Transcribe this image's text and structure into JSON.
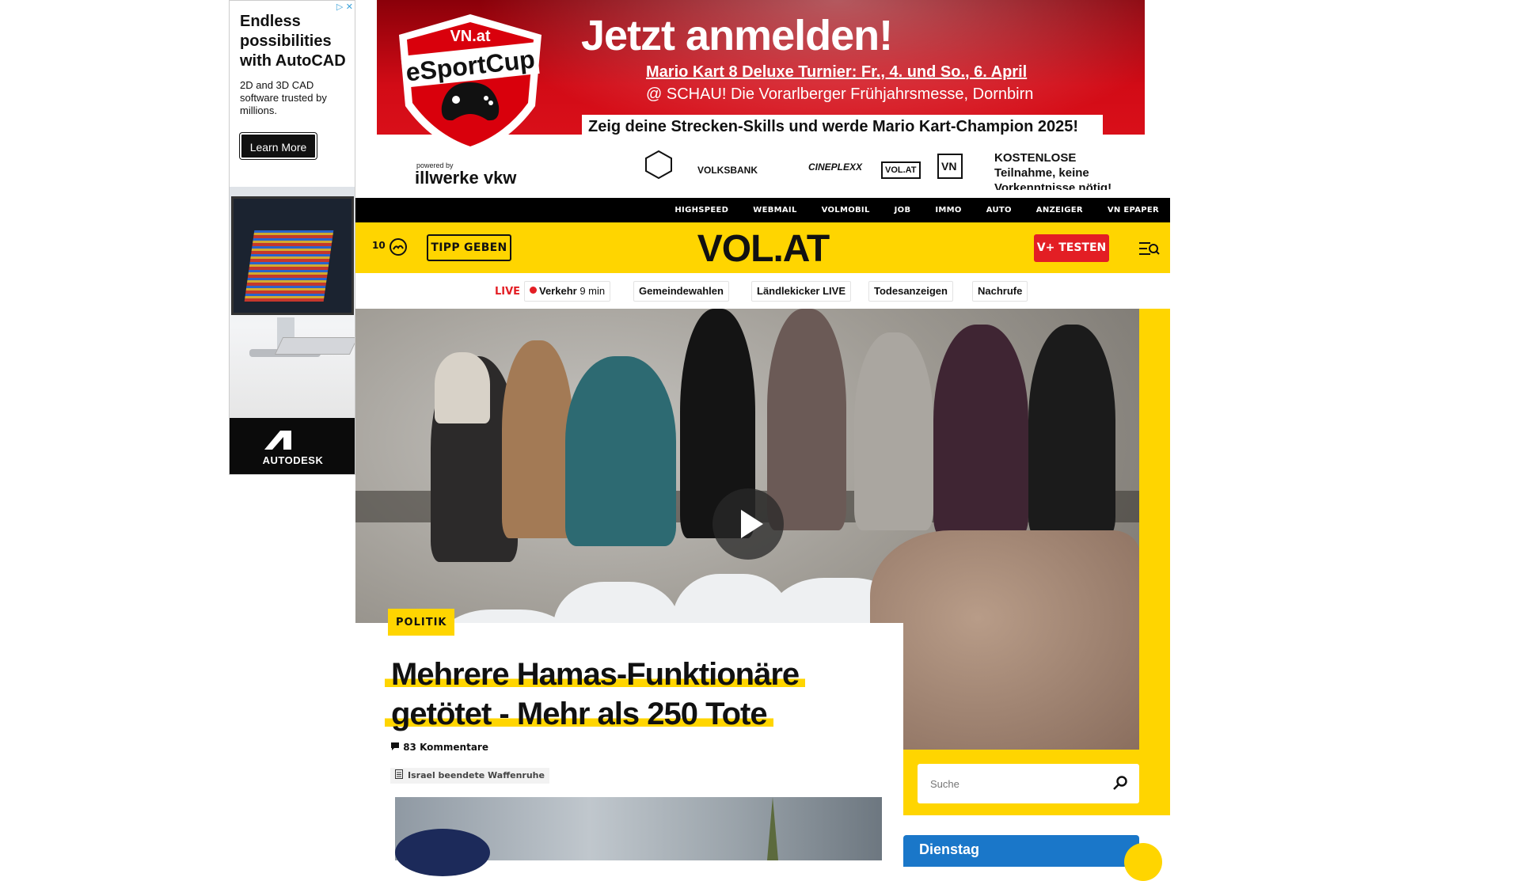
{
  "left_ad": {
    "close_glyphs": "▷ ✕",
    "headline": "Endless possibilities with AutoCAD",
    "subtext": "2D and 3D CAD software trusted by millions.",
    "button": "Learn More",
    "brand": "AUTODESK"
  },
  "top_banner": {
    "logo_top": "VN.at",
    "logo_name": "eSportCup",
    "title": "Jetzt anmelden!",
    "line1": "Mario Kart 8 Deluxe Turnier: Fr., 4. und So., 6. April",
    "line2": "@ SCHAU! Die Vorarlberger Frühjahrsmesse, Dornbirn",
    "cta": "Zeig deine Strecken-Skills und werde Mario Kart-Champion 2025!",
    "powered_by": "powered by",
    "sponsor_main": "illwerke vkw",
    "sponsors": [
      "VOLKSBANK",
      "CINEPLEXX",
      "VOL.AT",
      "VN"
    ],
    "right_text": "KOSTENLOSE Teilnahme, keine Vorkenntnisse nötig!"
  },
  "topnav": {
    "items": [
      "HIGHSPEED",
      "WEBMAIL",
      "VOLMOBIL",
      "JOB",
      "IMMO",
      "AUTO",
      "ANZEIGER",
      "VN EPAPER"
    ]
  },
  "header": {
    "temperature": "10",
    "tipp_button": "TIPP GEBEN",
    "logo": "VOL.AT",
    "plus_button": "V+ TESTEN",
    "icons": {
      "weather": "weather-icon",
      "menu": "menu-search-icon"
    }
  },
  "quicklinks": {
    "live_label": "LIVE",
    "traffic_label": "Verkehr",
    "traffic_time": "9 min",
    "chips": [
      "Gemeindewahlen",
      "Ländlekicker LIVE",
      "Todesanzeigen",
      "Nachrufe"
    ]
  },
  "article": {
    "category": "POLITIK",
    "title_line1": "Mehrere Hamas-Funktionäre",
    "title_line2": "getötet - Mehr als 250 Tote",
    "comments": "83 Kommentare",
    "related": "Israel beendete Waffenruhe"
  },
  "sidebar": {
    "search_placeholder": "Suche",
    "weather_day": "Dienstag"
  },
  "colors": {
    "brand_yellow": "#ffd500",
    "accent_red": "#e31e24",
    "nav_black": "#000000",
    "weather_blue": "#1a77c9"
  }
}
